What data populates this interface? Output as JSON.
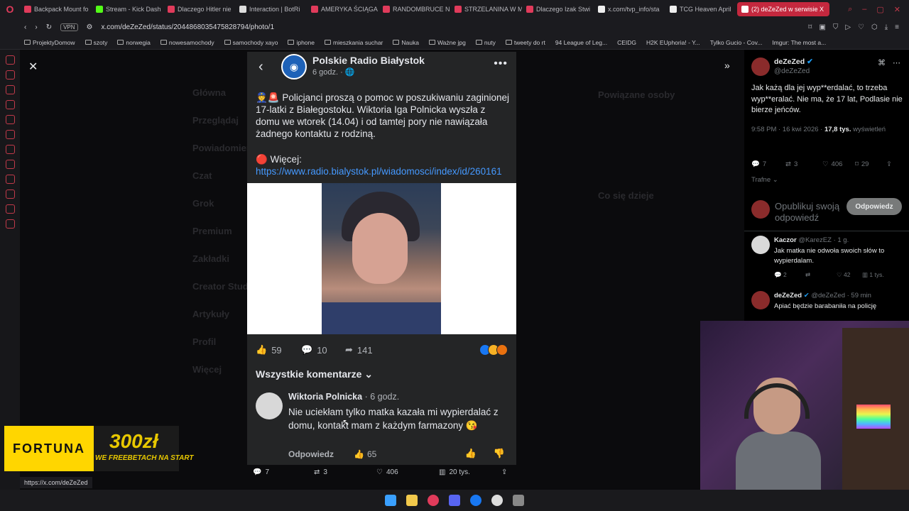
{
  "browser": {
    "tabs": [
      {
        "label": "Backpack Mount fo"
      },
      {
        "label": "Stream - Kick Dash"
      },
      {
        "label": "Dlaczego Hitler nie"
      },
      {
        "label": "Interaction | BotRi"
      },
      {
        "label": "AMERYKA ŚCIĄGA"
      },
      {
        "label": "RANDOMBRUCE N"
      },
      {
        "label": "STRZELANINA W M"
      },
      {
        "label": "Dlaczego Izak Stwi"
      },
      {
        "label": "x.com/tvp_info/sta"
      },
      {
        "label": "TCG Heaven April"
      },
      {
        "label": "(2) deZeZed w serwisie X"
      }
    ],
    "vpn_label": "VPN",
    "url": "x.com/deZeZed/status/2044868035475828794/photo/1",
    "bookmarks": [
      "ProjektyDomow",
      "szoty",
      "norwegia",
      "nowesamochody",
      "samochody xayo",
      "iphone",
      "mieszkania suchar",
      "Nauka",
      "Ważne jpg",
      "nuty",
      "tweety do rt",
      "94 League of Leg...",
      "CEIDG",
      "H2K EUphoria! - Y...",
      "Tylko Gucio - Cov...",
      "Imgur: The most a..."
    ],
    "status_url": "https://x.com/deZeZed"
  },
  "background_x": {
    "nav": [
      "Główna",
      "Przeglądaj",
      "Powiadomienia",
      "Czat",
      "Grok",
      "Premium",
      "Zakładki",
      "Creator Studio",
      "Artykuły",
      "Profil",
      "Więcej"
    ],
    "related_header": "Powiązane osoby",
    "whats_up": "Co się dzieje"
  },
  "fb_post": {
    "page_name": "Polskie Radio Białystok",
    "time": "6 godz.",
    "body": "👮🚨 Policjanci proszą o pomoc w poszukiwaniu zaginionej 17-latki z Białegostoku. Wiktoria Iga Polnicka wyszła z domu we wtorek (14.04) i od tamtej pory nie nawiązała żadnego kontaktu z rodziną.",
    "more_prefix": "🔴 Więcej: ",
    "link": "https://www.radio.bialystok.pl/wiadomosci/index/id/260161",
    "likes": "59",
    "comments": "10",
    "shares": "141",
    "all_comments": "Wszystkie komentarze",
    "comment": {
      "author": "Wiktoria Polnicka",
      "time": "6 godz.",
      "text": "Nie uciekłam tylko matka kazała mi wypierdalać z domu, kontakt mam z każdym farmazony 😘",
      "reply": "Odpowiedz",
      "likes": "65"
    }
  },
  "x_photo_actions": {
    "replies": "7",
    "reposts": "3",
    "likes": "406",
    "views": "20 tys."
  },
  "right_panel": {
    "author": "deZeZed",
    "handle": "@deZeZed",
    "tweet": "Jak każą dla jej wyp**erdalać, to trzeba wyp**eralać. Nie ma, że 17 lat, Podlasie nie bierze jeńców.",
    "timestamp": "9:58 PM · 16 kwi 2026 · ",
    "views": "17,8 tys.",
    "views_label": "wyświetleń",
    "replies": "7",
    "reposts": "3",
    "likes": "406",
    "bookmarks": "29",
    "sort": "Trafne",
    "reply_placeholder": "Opublikuj swoją odpowiedź",
    "reply_button": "Odpowiedz",
    "comments": [
      {
        "name": "Kaczor",
        "handle": "@KarezEZ · 1 g.",
        "text": "Jak matka nie odwoła swoich słów to wypierdalam.",
        "replies": "2",
        "likes": "42",
        "views": "1 tys."
      },
      {
        "name": "deZeZed",
        "handle": "@deZeZed · 59 min",
        "text": "Apiać będzie barabaniła na policję"
      }
    ]
  },
  "overlay": {
    "brand": "FORTUNA",
    "amount": "300zł",
    "tagline": "WE FREEBETACH NA START"
  },
  "colors": {
    "fb_bg": "#242526",
    "link": "#4599ff",
    "verified": "#1d9bf0",
    "active_tab": "#c4283e"
  }
}
